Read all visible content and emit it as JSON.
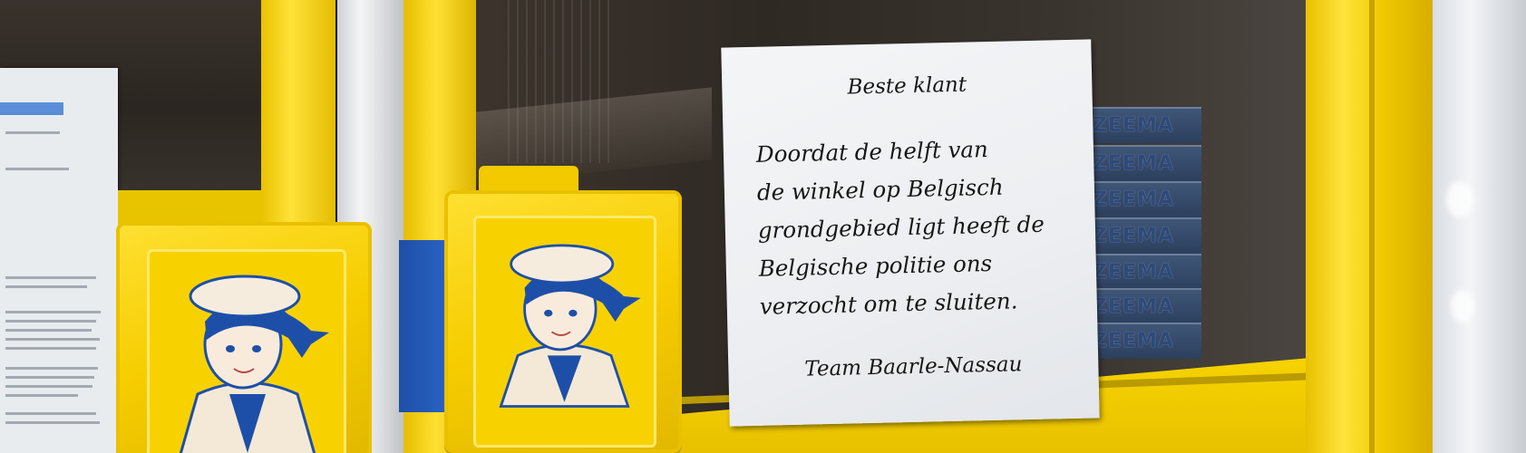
{
  "sign": {
    "heading": "Beste klant",
    "lines": [
      "Doordat de helft van",
      "de winkel op Belgisch",
      "grondgebied ligt heeft de",
      "Belgische politie ons",
      "verzocht om te sluiten."
    ],
    "footer": "Team Baarle-Nassau"
  },
  "store_shelf_text": [
    "ZEEMA",
    "ZEEMA",
    "ZEEMA",
    "ZEEMA",
    "ZEEMA",
    "ZEEMA",
    "ZEEMA"
  ],
  "colors": {
    "frame_yellow": "#f5cf00",
    "mascot_blue": "#1e4fa8",
    "sign_paper": "#f0f1f3"
  }
}
